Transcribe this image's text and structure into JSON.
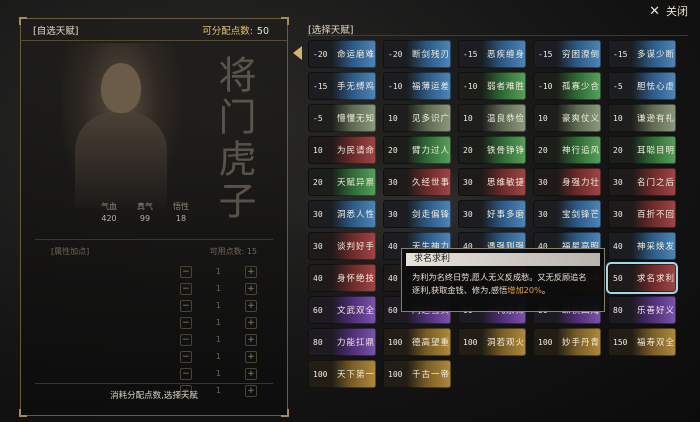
{
  "header": {
    "close_label": "关闭",
    "close_icon": "close-icon"
  },
  "left_panel": {
    "title": "[自选天赋]",
    "points_label": "可分配点数:",
    "points_value": "50",
    "calligraphy": "将门虎子",
    "stats": [
      {
        "label": "气血",
        "value": "420"
      },
      {
        "label": "真气",
        "value": "99"
      },
      {
        "label": "悟性",
        "value": "18"
      }
    ],
    "alloc_header_left": "[属性加点]",
    "alloc_header_right": "可用点数: 15",
    "alloc_rows": [
      {
        "name": "",
        "value": "1"
      },
      {
        "name": "",
        "value": "1"
      },
      {
        "name": "",
        "value": "1"
      },
      {
        "name": "",
        "value": "1"
      },
      {
        "name": "",
        "value": "1"
      },
      {
        "name": "",
        "value": "1"
      },
      {
        "name": "",
        "value": "1"
      },
      {
        "name": "",
        "value": "1"
      }
    ],
    "footer": "消耗分配点数,选择天赋"
  },
  "right_panel": {
    "title": "[选择天赋]",
    "talents": [
      {
        "cost": "-20",
        "name": "命运磨难",
        "color": "blue"
      },
      {
        "cost": "-20",
        "name": "断剑残刃",
        "color": "blue"
      },
      {
        "cost": "-15",
        "name": "恶疾缠身",
        "color": "blue"
      },
      {
        "cost": "-15",
        "name": "穷困潦倒",
        "color": "blue"
      },
      {
        "cost": "-15",
        "name": "多谋少断",
        "color": "blue"
      },
      {
        "cost": "-15",
        "name": "手无缚鸡",
        "color": "blue"
      },
      {
        "cost": "-10",
        "name": "福薄运差",
        "color": "blue"
      },
      {
        "cost": "-10",
        "name": "弱者难胜",
        "color": "green"
      },
      {
        "cost": "-10",
        "name": "孤寡少合",
        "color": "green"
      },
      {
        "cost": "-5",
        "name": "胆怯心虚",
        "color": "blue"
      },
      {
        "cost": "-5",
        "name": "懵懂无知",
        "color": "gray"
      },
      {
        "cost": "10",
        "name": "见多识广",
        "color": "gray"
      },
      {
        "cost": "10",
        "name": "温良恭俭",
        "color": "gray"
      },
      {
        "cost": "10",
        "name": "豪爽仗义",
        "color": "gray"
      },
      {
        "cost": "10",
        "name": "谦逊有礼",
        "color": "gray"
      },
      {
        "cost": "10",
        "name": "为民请命",
        "color": "red"
      },
      {
        "cost": "20",
        "name": "臂力过人",
        "color": "green"
      },
      {
        "cost": "20",
        "name": "铁骨铮铮",
        "color": "green"
      },
      {
        "cost": "20",
        "name": "神行追风",
        "color": "green"
      },
      {
        "cost": "20",
        "name": "耳聪目明",
        "color": "green"
      },
      {
        "cost": "20",
        "name": "天赋异禀",
        "color": "green"
      },
      {
        "cost": "30",
        "name": "久经世事",
        "color": "red"
      },
      {
        "cost": "30",
        "name": "思维敏捷",
        "color": "red"
      },
      {
        "cost": "30",
        "name": "身强力壮",
        "color": "red"
      },
      {
        "cost": "30",
        "name": "名门之后",
        "color": "red"
      },
      {
        "cost": "30",
        "name": "洞悉人性",
        "color": "blue"
      },
      {
        "cost": "30",
        "name": "剑走偏锋",
        "color": "blue"
      },
      {
        "cost": "30",
        "name": "好事多磨",
        "color": "blue"
      },
      {
        "cost": "30",
        "name": "宝剑锋芒",
        "color": "blue"
      },
      {
        "cost": "30",
        "name": "百折不回",
        "color": "red"
      },
      {
        "cost": "30",
        "name": "谈判好手",
        "color": "red"
      },
      {
        "cost": "40",
        "name": "天生神力",
        "color": "blue"
      },
      {
        "cost": "40",
        "name": "遇强则强",
        "color": "blue"
      },
      {
        "cost": "40",
        "name": "福星高照",
        "color": "blue"
      },
      {
        "cost": "40",
        "name": "神采焕发",
        "color": "blue"
      },
      {
        "cost": "40",
        "name": "身怀绝技",
        "color": "red"
      },
      {
        "cost": "40",
        "name": "聚精会神",
        "color": "red"
      },
      {
        "cost": "50",
        "name": "以一当十",
        "color": "red"
      },
      {
        "cost": "50",
        "name": "百发百中",
        "color": "red"
      },
      {
        "cost": "50",
        "name": "求名求利",
        "color": "red"
      },
      {
        "cost": "60",
        "name": "文武双全",
        "color": "purple"
      },
      {
        "cost": "60",
        "name": "鸿运当头",
        "color": "purple"
      },
      {
        "cost": "60",
        "name": "一代宗师",
        "color": "purple"
      },
      {
        "cost": "80",
        "name": "纵横四海",
        "color": "purple"
      },
      {
        "cost": "80",
        "name": "乐善好义",
        "color": "purple"
      },
      {
        "cost": "80",
        "name": "力能扛鼎",
        "color": "purple"
      },
      {
        "cost": "100",
        "name": "德高望重",
        "color": "gold"
      },
      {
        "cost": "100",
        "name": "洞若观火",
        "color": "gold"
      },
      {
        "cost": "100",
        "name": "妙手丹青",
        "color": "gold"
      },
      {
        "cost": "150",
        "name": "福寿双全",
        "color": "gold"
      },
      {
        "cost": "100",
        "name": "天下第一",
        "color": "gold"
      },
      {
        "cost": "100",
        "name": "千古一帝",
        "color": "gold"
      }
    ],
    "selected_index": 39
  },
  "tooltip": {
    "title": "求名求利",
    "body_part1": "为利为名终日劳,愿人无义反成愁。又无反顾追名逐利,获取金钱、修为,感悟",
    "body_highlight": "增加20%",
    "body_part2": "。"
  }
}
